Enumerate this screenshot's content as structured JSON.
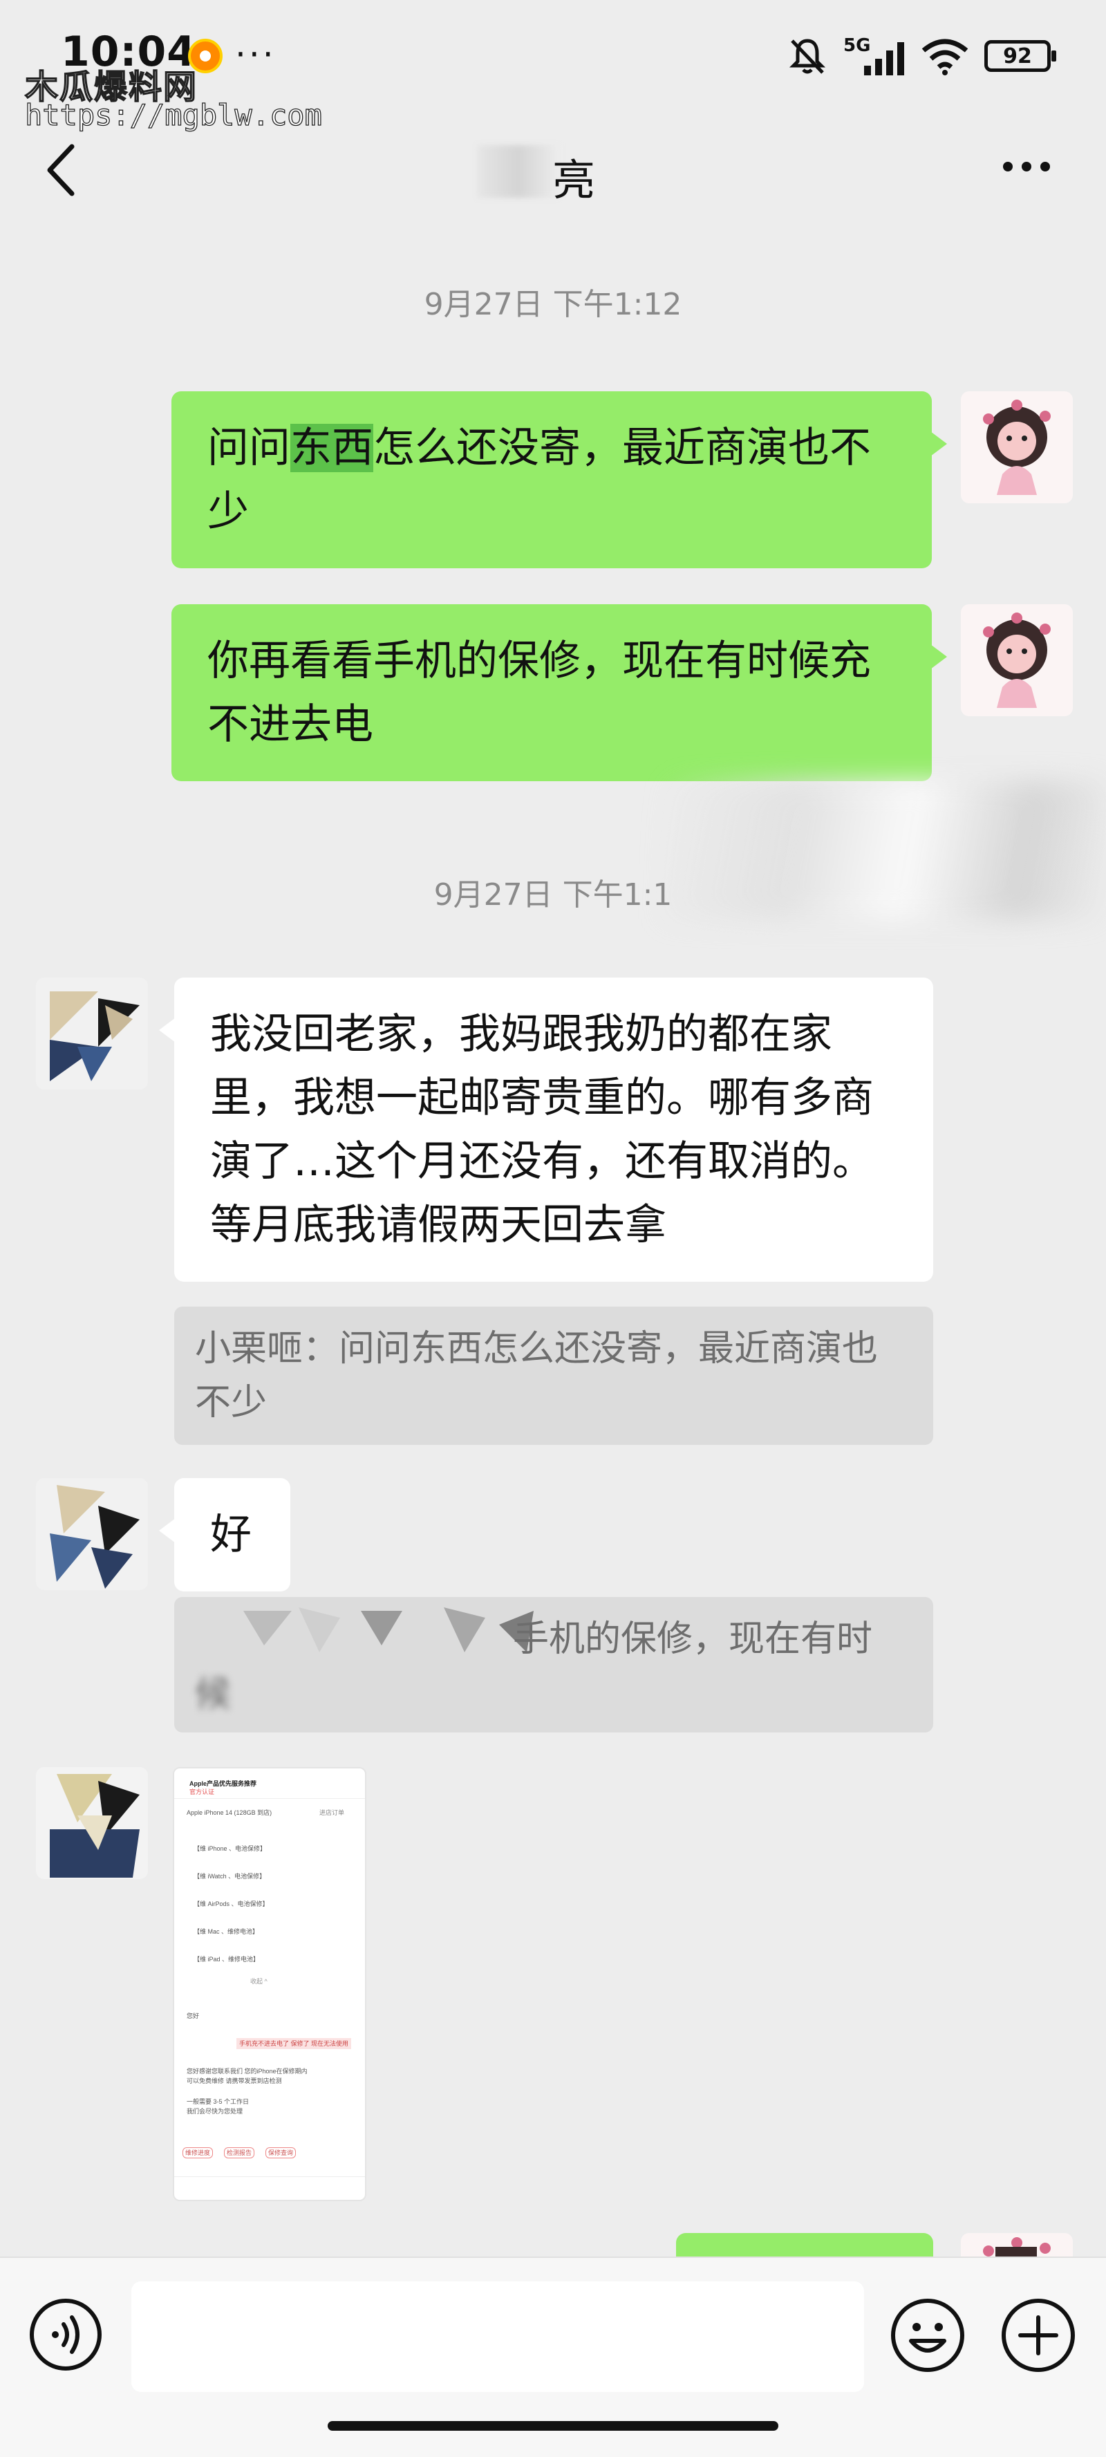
{
  "status_bar": {
    "time": "10:04",
    "network": "5G",
    "battery": "92",
    "watermark_name": "木瓜爆料网",
    "watermark_url": "https://mgblw.com"
  },
  "header": {
    "contact_name": "亮",
    "back_icon": "chevron-left-icon",
    "menu_icon": "more-dots-icon"
  },
  "messages": [
    {
      "type": "timestamp",
      "text": "9月27日 下午1:12"
    },
    {
      "type": "sent",
      "parts": [
        "问问",
        "东西",
        "怎么还没寄，最近商演也不少"
      ]
    },
    {
      "type": "sent",
      "text": "你再看看手机的保修，现在有时候充不进去电"
    },
    {
      "type": "timestamp",
      "text": "9月27日 下午1:1"
    },
    {
      "type": "received",
      "text": "我没回老家，我妈跟我奶的都在家里，我想一起邮寄贵重的。哪有多商演了…这个月还没有，还有取消的。等月底我请假两天回去拿",
      "quote": "小栗咂：问问东西怎么还没寄，最近商演也不少"
    },
    {
      "type": "received",
      "text": "好",
      "quote_line1": "手机的保修，现在有时",
      "quote_line2": "候"
    },
    {
      "type": "received-image"
    }
  ],
  "shared_image": {
    "top_bar": "Apple产品优先服务推荐",
    "badge": "官方认证",
    "subtitle": "Apple iPhone 14 (128GB 到店)",
    "button": "进店订单",
    "items": [
      "【维 iPhone 、电池保修】",
      "【维 iWatch 、电池保修】",
      "【维 AirPods 、电池保修】",
      "【维 Mac 、维修电池】",
      "【维 iPad 、维修电池】"
    ],
    "collapse": "收起 ^",
    "greeting": "您好",
    "bubble_text": "手机充不进去电了 保修了 现在无法使用",
    "reply_1": "您好感谢您联系我们 您的iPhone在保修期内",
    "reply_2": "可以免费维修 请携带发票到店检测",
    "reply_3": "一般需要 3-5 个工作日",
    "reply_4": "我们会尽快为您处理",
    "footer_1": "维修进度",
    "footer_2": "检测报告",
    "footer_3": "保修查询"
  },
  "input_bar": {
    "voice_icon": "voice-icon",
    "emoji_icon": "emoji-icon",
    "plus_icon": "plus-icon",
    "placeholder": ""
  },
  "colors": {
    "sent_bubble": "#95ec69",
    "highlight": "#5cc14a",
    "received_bubble": "#ffffff",
    "background": "#ededed",
    "quote_bg": "#dcdcdc"
  }
}
